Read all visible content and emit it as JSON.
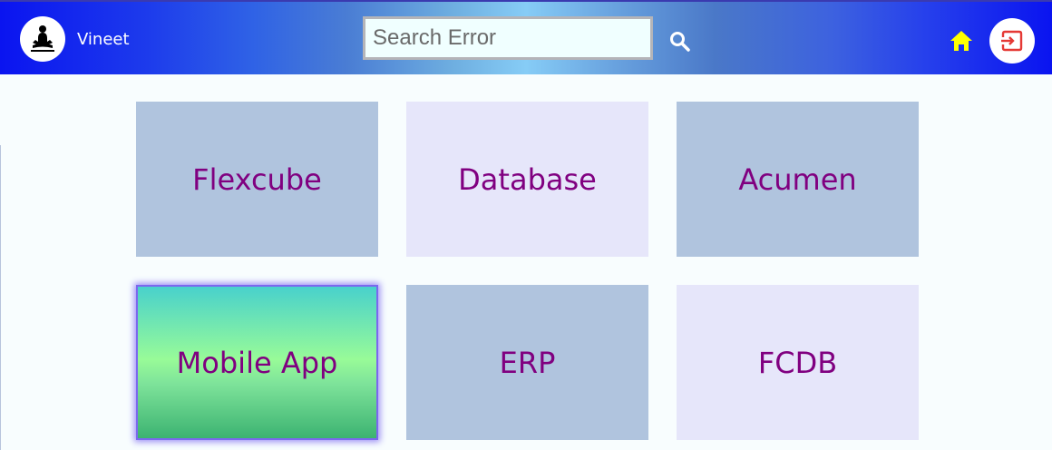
{
  "header": {
    "username": "Vineet",
    "search_placeholder": "Search Error",
    "search_value": ""
  },
  "icons": {
    "avatar": "meditation-figure-icon",
    "search": "search-icon",
    "home": "home-icon",
    "logout": "logout-icon"
  },
  "colors": {
    "tile_text": "#800080",
    "tile_blue": "#b0c4de",
    "tile_lavender": "#e6e6fa",
    "home_icon": "#ffff00",
    "logout_icon": "#e53935"
  },
  "tiles": [
    {
      "label": "Flexcube"
    },
    {
      "label": "Database"
    },
    {
      "label": "Acumen"
    },
    {
      "label": "Mobile App"
    },
    {
      "label": "ERP"
    },
    {
      "label": "FCDB"
    }
  ]
}
